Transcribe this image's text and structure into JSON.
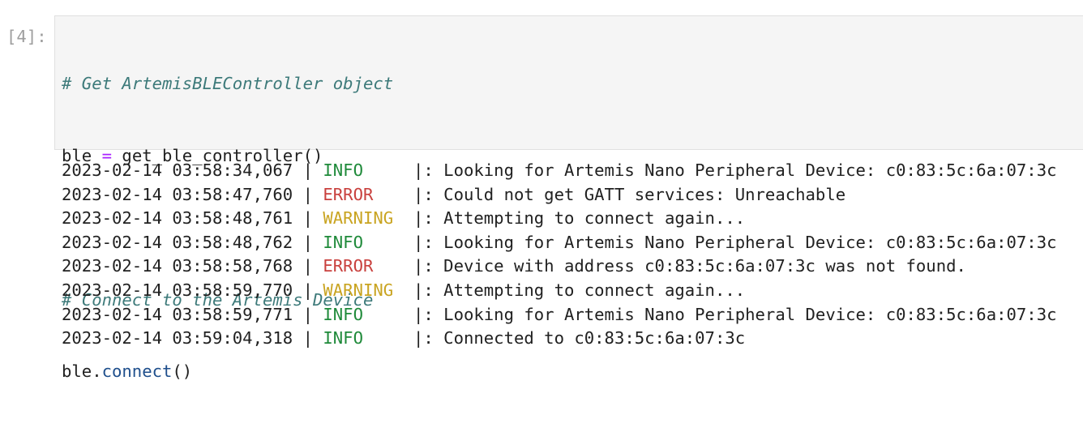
{
  "cell": {
    "prompt": "[4]:",
    "code": [
      {
        "type": "comment",
        "text": "# Get ArtemisBLEController object"
      },
      {
        "type": "assign",
        "lhs": "ble ",
        "op": "=",
        "rhs": " get_ble_controller()"
      },
      {
        "type": "blank",
        "text": ""
      },
      {
        "type": "comment",
        "text": "# Connect to the Artemis Device"
      },
      {
        "type": "call",
        "obj": "ble.",
        "method": "connect",
        "args": "()"
      }
    ]
  },
  "output": {
    "log": [
      {
        "ts": "2023-02-14 03:58:34,067",
        "sep": " | ",
        "level": "INFO",
        "pad": "     ",
        "msg": "|: Looking for Artemis Nano Peripheral Device: c0:83:5c:6a:07:3c"
      },
      {
        "ts": "2023-02-14 03:58:47,760",
        "sep": " | ",
        "level": "ERROR",
        "pad": "    ",
        "msg": "|: Could not get GATT services: Unreachable"
      },
      {
        "ts": "2023-02-14 03:58:48,761",
        "sep": " | ",
        "level": "WARNING",
        "pad": "  ",
        "msg": "|: Attempting to connect again..."
      },
      {
        "ts": "2023-02-14 03:58:48,762",
        "sep": " | ",
        "level": "INFO",
        "pad": "     ",
        "msg": "|: Looking for Artemis Nano Peripheral Device: c0:83:5c:6a:07:3c"
      },
      {
        "ts": "2023-02-14 03:58:58,768",
        "sep": " | ",
        "level": "ERROR",
        "pad": "    ",
        "msg": "|: Device with address c0:83:5c:6a:07:3c was not found."
      },
      {
        "ts": "2023-02-14 03:58:59,770",
        "sep": " | ",
        "level": "WARNING",
        "pad": "  ",
        "msg": "|: Attempting to connect again..."
      },
      {
        "ts": "2023-02-14 03:58:59,771",
        "sep": " | ",
        "level": "INFO",
        "pad": "     ",
        "msg": "|: Looking for Artemis Nano Peripheral Device: c0:83:5c:6a:07:3c"
      },
      {
        "ts": "2023-02-14 03:59:04,318",
        "sep": " | ",
        "level": "INFO",
        "pad": "     ",
        "msg": "|: Connected to c0:83:5c:6a:07:3c"
      }
    ]
  },
  "colors": {
    "info": "#1f8a3a",
    "error": "#c9413e",
    "warning": "#c9a421",
    "comment": "#3d7a7a",
    "operator": "#aa22ff",
    "property": "#1f4f8c",
    "prompt": "#9e9e9e",
    "cell_background": "#f5f5f5"
  }
}
